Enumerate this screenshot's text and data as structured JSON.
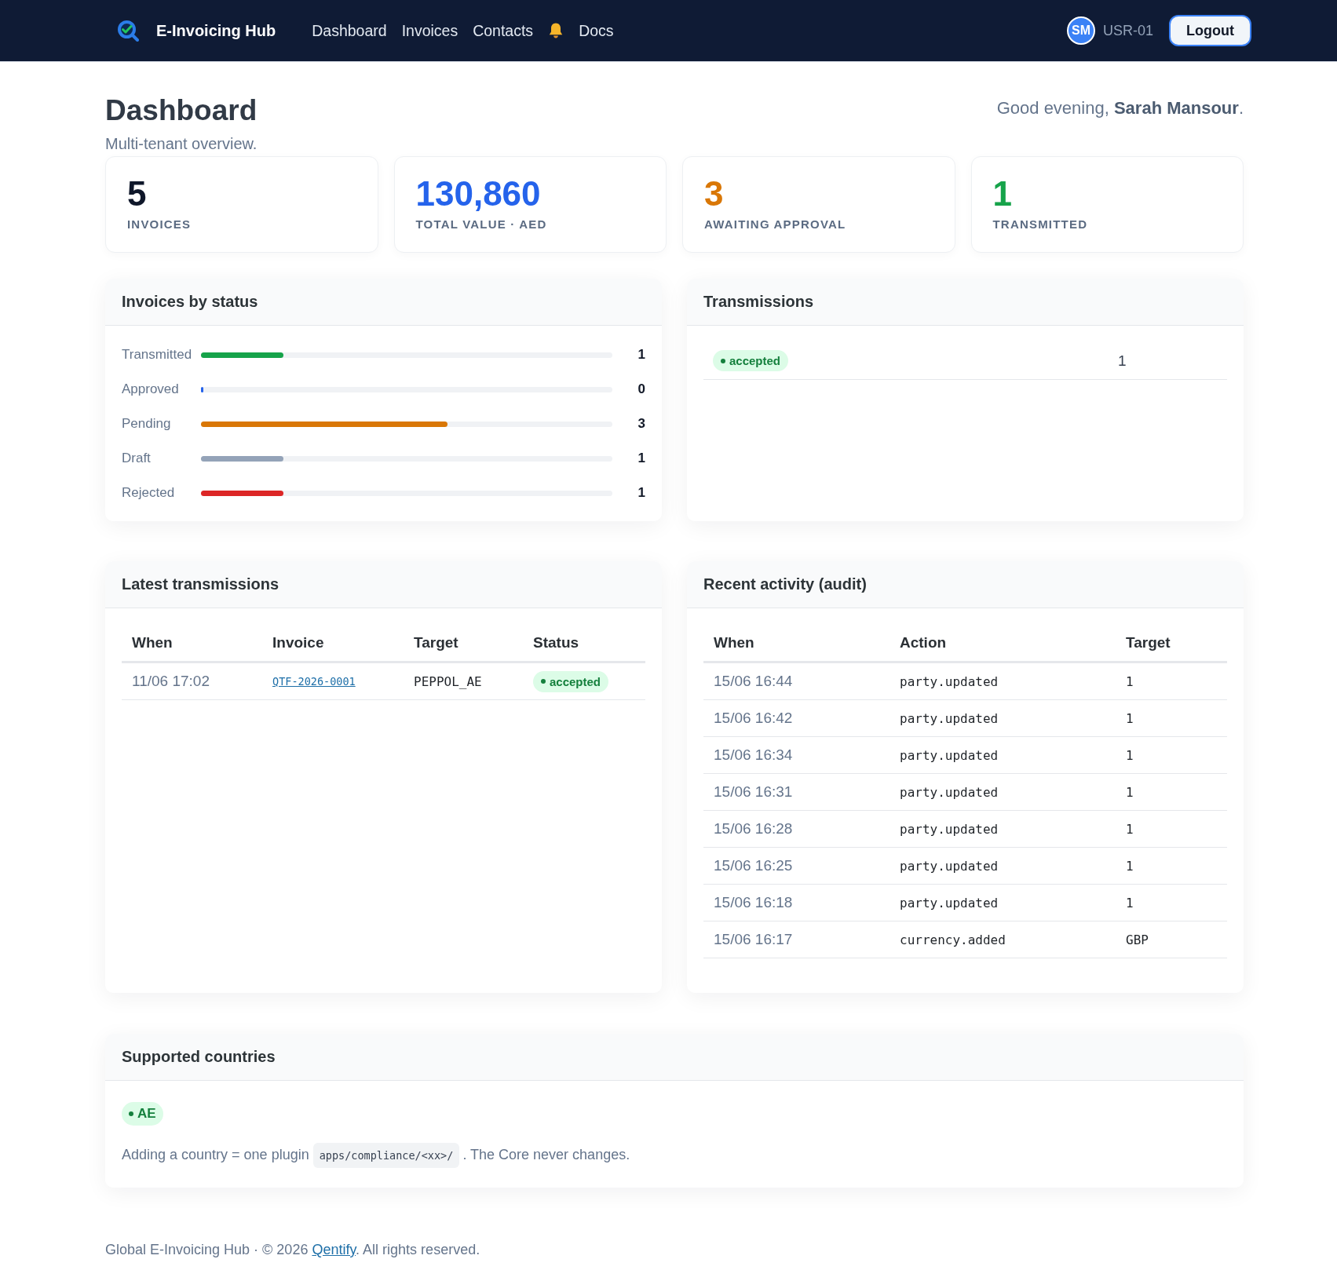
{
  "navbar": {
    "brand": "E-Invoicing Hub",
    "links": [
      {
        "kind": "link",
        "label": "Dashboard"
      },
      {
        "kind": "link",
        "label": "Invoices"
      },
      {
        "kind": "link",
        "label": "Contacts"
      },
      {
        "kind": "bell"
      },
      {
        "kind": "link",
        "label": "Docs"
      }
    ],
    "user": {
      "initials": "SM",
      "id": "USR-01"
    },
    "logout": "Logout"
  },
  "header": {
    "title": "Dashboard",
    "subtitle": "Multi-tenant overview.",
    "greeting": "Good evening, **Sarah Mansour**."
  },
  "stats": [
    {
      "value": "5",
      "label": "INVOICES",
      "color": "#0f172a"
    },
    {
      "value": "130,860",
      "label": "TOTAL VALUE · AED",
      "color": "#2563eb"
    },
    {
      "value": "3",
      "label": "AWAITING APPROVAL",
      "color": "#d97706"
    },
    {
      "value": "1",
      "label": "TRANSMITTED",
      "color": "#16a34a"
    }
  ],
  "status_panel": {
    "title": "Invoices by status",
    "rows": [
      {
        "label": "Transmitted",
        "count": "1",
        "level": 0.2,
        "color": "#16a34a"
      },
      {
        "label": "Approved",
        "count": "0",
        "level": 0,
        "color": "#2563eb"
      },
      {
        "label": "Pending",
        "count": "3",
        "level": 0.6,
        "color": "#d97706"
      },
      {
        "label": "Draft",
        "count": "1",
        "level": 0.2,
        "color": "#94a3b8"
      },
      {
        "label": "Rejected",
        "count": "1",
        "level": 0.2,
        "color": "#dc2626"
      }
    ]
  },
  "transmissions_panel": {
    "title": "Transmissions",
    "rows": [
      {
        "status": "accepted",
        "count": "1"
      }
    ]
  },
  "latest_transmissions": {
    "title": "Latest transmissions",
    "columns": [
      "When",
      "Invoice",
      "Target",
      "Status"
    ],
    "rows": [
      {
        "when": "11/06 17:02",
        "invoice": "QTF-2026-0001",
        "target": "PEPPOL_AE",
        "status": "accepted"
      }
    ]
  },
  "recent_activity": {
    "title": "Recent activity (audit)",
    "columns": [
      "When",
      "Action",
      "Target"
    ],
    "rows": [
      {
        "when": "15/06 16:44",
        "action": "party.updated",
        "target": "1"
      },
      {
        "when": "15/06 16:42",
        "action": "party.updated",
        "target": "1"
      },
      {
        "when": "15/06 16:34",
        "action": "party.updated",
        "target": "1"
      },
      {
        "when": "15/06 16:31",
        "action": "party.updated",
        "target": "1"
      },
      {
        "when": "15/06 16:28",
        "action": "party.updated",
        "target": "1"
      },
      {
        "when": "15/06 16:25",
        "action": "party.updated",
        "target": "1"
      },
      {
        "when": "15/06 16:18",
        "action": "party.updated",
        "target": "1"
      },
      {
        "when": "15/06 16:17",
        "action": "currency.added",
        "target": "GBP"
      }
    ]
  },
  "supported_countries": {
    "title": "Supported countries",
    "countries": [
      "AE"
    ],
    "note": {
      "text_before": "Adding a country = one plugin",
      "code": "apps/compliance/<xx>/",
      "text_after": ". The Core never changes."
    }
  },
  "footer": {
    "text_before": "Global E-Invoicing Hub · © 2026 ",
    "link": "Qentify",
    "text_after": ". All rights reserved."
  }
}
